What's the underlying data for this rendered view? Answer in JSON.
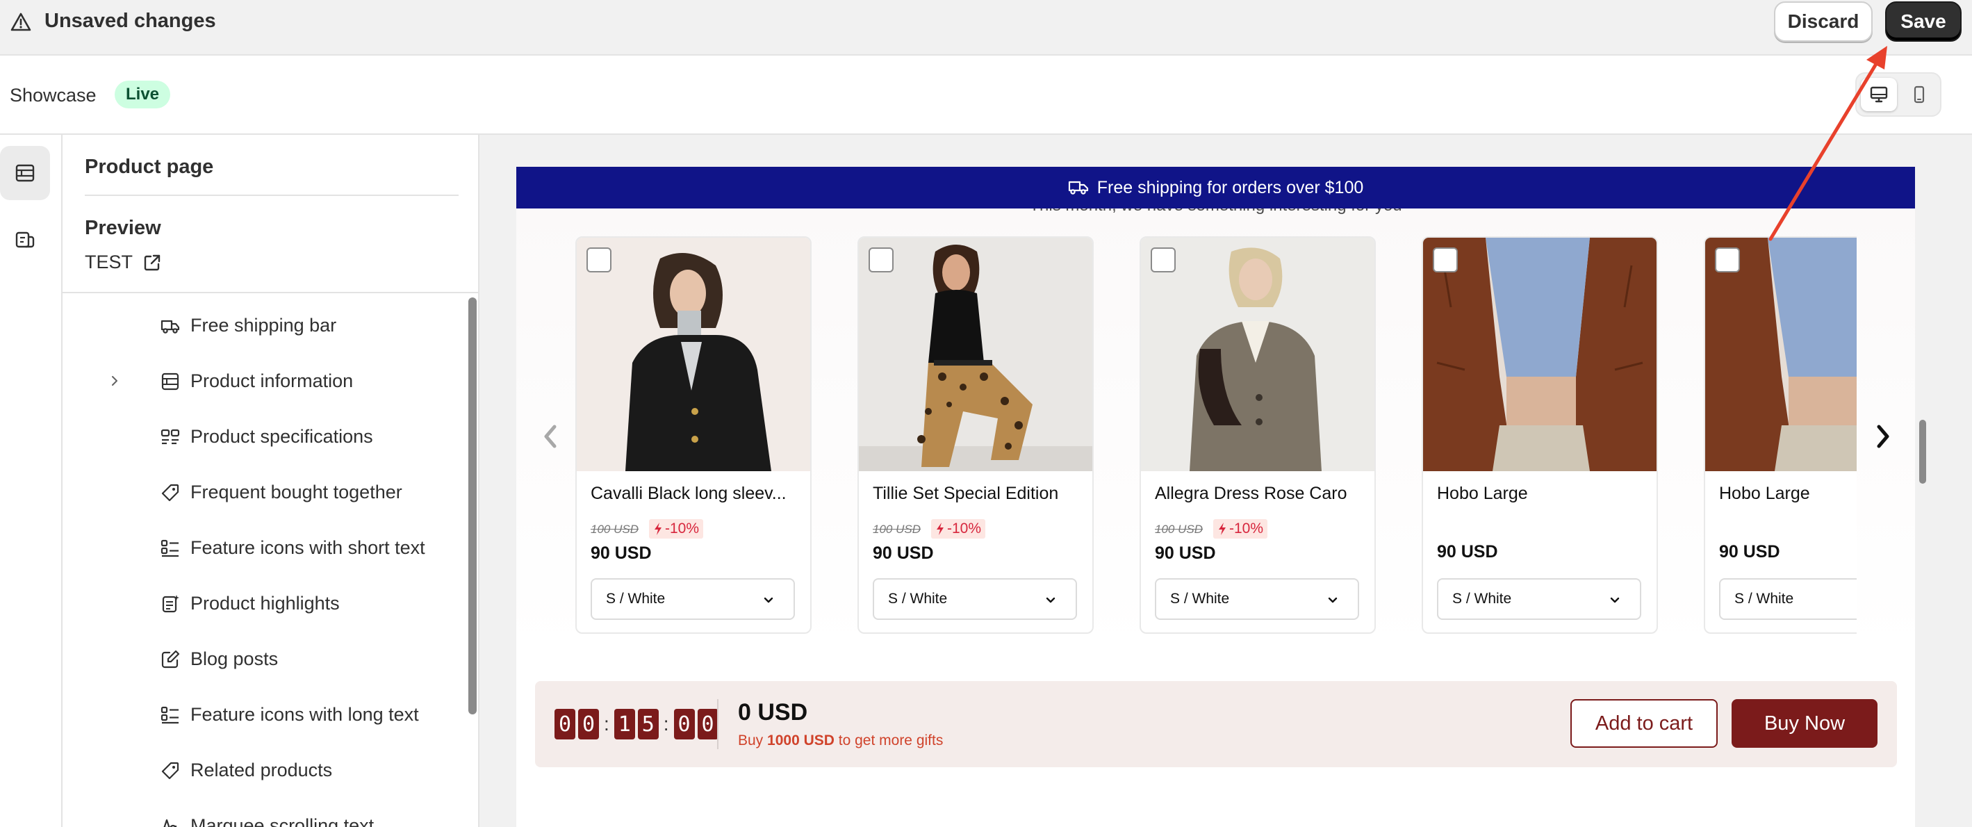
{
  "topbar": {
    "title": "Unsaved changes",
    "discard_label": "Discard",
    "save_label": "Save"
  },
  "header": {
    "theme_name": "Showcase",
    "status_badge": "Live"
  },
  "sidebar": {
    "page_title": "Product page",
    "preview_label": "Preview",
    "preview_product": "TEST",
    "items": [
      {
        "label": "Free shipping bar",
        "icon": "truck-icon"
      },
      {
        "label": "Product information",
        "icon": "layout-icon"
      },
      {
        "label": "Product specifications",
        "icon": "specs-icon"
      },
      {
        "label": "Frequent bought together",
        "icon": "tag-icon"
      },
      {
        "label": "Feature icons with short text",
        "icon": "list-icon"
      },
      {
        "label": "Product highlights",
        "icon": "highlights-icon"
      },
      {
        "label": "Blog posts",
        "icon": "edit-icon"
      },
      {
        "label": "Feature icons with long text",
        "icon": "list-icon"
      },
      {
        "label": "Related products",
        "icon": "tag-icon"
      },
      {
        "label": "Marquee scrolling text",
        "icon": "text-icon"
      }
    ]
  },
  "preview": {
    "shipping_bar_text": "Free shipping for orders over $100",
    "ghost_subtitle": "This month, we have something interesting for you",
    "products": [
      {
        "name": "Cavalli Black long sleev...",
        "old_price": "100 USD",
        "discount": "-10%",
        "price": "90 USD",
        "variant": "S / White"
      },
      {
        "name": "Tillie Set Special Edition",
        "old_price": "100 USD",
        "discount": "-10%",
        "price": "90 USD",
        "variant": "S / White"
      },
      {
        "name": "Allegra Dress Rose Caro",
        "old_price": "100 USD",
        "discount": "-10%",
        "price": "90 USD",
        "variant": "S / White"
      },
      {
        "name": "Hobo Large",
        "old_price": "",
        "discount": "",
        "price": "90 USD",
        "variant": "S / White"
      },
      {
        "name": "Hobo Large",
        "old_price": "",
        "discount": "",
        "price": "90 USD",
        "variant": "S / White"
      }
    ],
    "buybar": {
      "timer": [
        "0",
        "0",
        "1",
        "5",
        "0",
        "0"
      ],
      "total": "0 USD",
      "hint_prefix": "Buy",
      "hint_amount": "1000 USD",
      "hint_suffix": "to get more gifts",
      "add_to_cart_label": "Add to cart",
      "buy_now_label": "Buy Now"
    }
  },
  "colors": {
    "brand_navy": "#101488",
    "buy_maroon": "#7b1b1b",
    "badge_green": "#cdfee1",
    "annotation_red": "#e8412c"
  }
}
